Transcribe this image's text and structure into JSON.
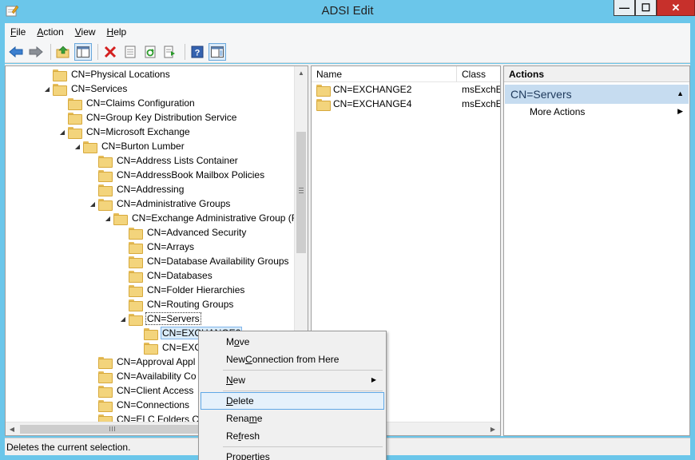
{
  "window": {
    "title": "ADSI Edit",
    "min_glyph": "—",
    "max_glyph": "☐",
    "close_glyph": "✕"
  },
  "menu": [
    {
      "label_pre": "",
      "key": "F",
      "label_post": "ile"
    },
    {
      "label_pre": "",
      "key": "A",
      "label_post": "ction"
    },
    {
      "label_pre": "",
      "key": "V",
      "label_post": "iew"
    },
    {
      "label_pre": "",
      "key": "H",
      "label_post": "elp"
    }
  ],
  "tree": [
    {
      "label": "CN=Physical Locations"
    },
    {
      "label": "CN=Services",
      "expander": "◢"
    },
    {
      "label": "CN=Claims Configuration"
    },
    {
      "label": "CN=Group Key Distribution Service"
    },
    {
      "label": "CN=Microsoft Exchange",
      "expander": "◢"
    },
    {
      "label": "CN=Burton Lumber",
      "expander": "◢"
    },
    {
      "label": "CN=Address Lists Container"
    },
    {
      "label": "CN=AddressBook Mailbox Policies"
    },
    {
      "label": "CN=Addressing"
    },
    {
      "label": "CN=Administrative Groups",
      "expander": "◢"
    },
    {
      "label": "CN=Exchange Administrative Group (F",
      "expander": "◢"
    },
    {
      "label": "CN=Advanced Security"
    },
    {
      "label": "CN=Arrays"
    },
    {
      "label": "CN=Database Availability Groups"
    },
    {
      "label": "CN=Databases"
    },
    {
      "label": "CN=Folder Hierarchies"
    },
    {
      "label": "CN=Routing Groups"
    },
    {
      "label": "CN=Servers",
      "expander": "◢"
    },
    {
      "label": "CN=EXCHANGE2"
    },
    {
      "label": "CN=EXC"
    },
    {
      "label": "CN=Approval Appl"
    },
    {
      "label": "CN=Availability Co"
    },
    {
      "label": "CN=Client Access"
    },
    {
      "label": "CN=Connections"
    },
    {
      "label": "CN=ELC Folders Co"
    }
  ],
  "details": {
    "columns": {
      "name": "Name",
      "class": "Class"
    },
    "rows": [
      {
        "name": "CN=EXCHANGE2",
        "class": "msExchEx"
      },
      {
        "name": "CN=EXCHANGE4",
        "class": "msExchEx"
      }
    ]
  },
  "actions": {
    "header": "Actions",
    "section": "CN=Servers",
    "items": [
      {
        "label": "More Actions"
      }
    ]
  },
  "context_menu": {
    "move": {
      "pre": "M",
      "key": "o",
      "post": "ve"
    },
    "new_connection": {
      "pre": "New ",
      "key": "C",
      "post": "onnection from Here"
    },
    "new": {
      "pre": "",
      "key": "N",
      "post": "ew"
    },
    "delete": {
      "pre": "",
      "key": "D",
      "post": "elete"
    },
    "rename": {
      "pre": "Rena",
      "key": "m",
      "post": "e"
    },
    "refresh": {
      "pre": "Re",
      "key": "f",
      "post": "resh"
    },
    "properties": {
      "pre": "P",
      "key": "r",
      "post": "operties"
    }
  },
  "status": "Deletes the current selection.",
  "icons": {
    "back": "arrow-left-icon",
    "forward": "arrow-right-icon",
    "up": "up-folder-icon",
    "show-hide": "console-tree-icon",
    "delete": "red-x-icon",
    "properties": "properties-icon",
    "refresh": "refresh-icon",
    "export": "export-list-icon",
    "help": "help-icon",
    "action-pane": "action-pane-icon"
  }
}
